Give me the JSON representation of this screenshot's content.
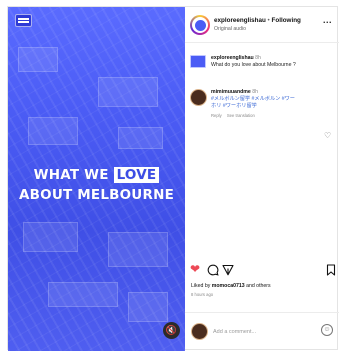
{
  "post": {
    "media": {
      "headline_line1_prefix": "WHAT WE",
      "headline_line1_highlight": "LOVE",
      "headline_line2": "ABOUT MELBOURNE",
      "mute_icon": "mute-icon"
    },
    "header": {
      "username": "exploreenglishau",
      "separator": " • ",
      "follow_status": "Following",
      "subtitle": "Original audio",
      "more_label": "..."
    },
    "comments": [
      {
        "username": "exploreenglishau",
        "time": "8h",
        "text": "What do you love about Melbourne ?"
      },
      {
        "username": "mimimuuandme",
        "time": "8h",
        "text_lines": [
          "#メルボルン留学 #メルボルン #ワー",
          "ホリ #ワーホリ留学"
        ],
        "actions": [
          "Reply",
          "See translation"
        ]
      }
    ],
    "actions": {
      "like_icon": "heart-filled-icon",
      "comment_icon": "comment-icon",
      "share_icon": "share-icon",
      "save_icon": "bookmark-icon",
      "like_color": "#ed4956"
    },
    "likes": {
      "prefix": "Liked by ",
      "user": "momoca0713",
      "suffix": " and others"
    },
    "timestamp": "8 hours ago",
    "comment_input": {
      "placeholder": "Add a comment..."
    }
  },
  "colors": {
    "media_background": "#4b5cf5",
    "hashtag_blue": "#3d6ad6"
  }
}
